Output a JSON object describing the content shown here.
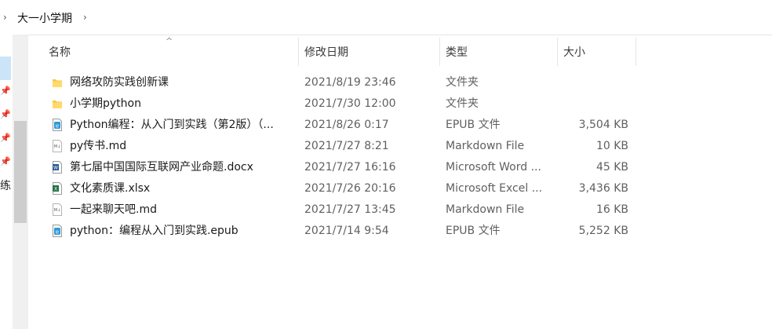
{
  "breadcrumb": {
    "back_chevron": "›",
    "folder": "大一小学期",
    "next_chevron": "›"
  },
  "nav": {
    "cut_text": "练",
    "pins": [
      "pin-icon",
      "pin-icon",
      "pin-icon",
      "pin-icon"
    ]
  },
  "columns": {
    "name": "名称",
    "modified": "修改日期",
    "type": "类型",
    "size": "大小",
    "sort_indicator": "^"
  },
  "files": [
    {
      "name": "网络攻防实践创新课",
      "modified": "2021/8/19 23:46",
      "type": "文件夹",
      "size": "",
      "icon": "folder-icon"
    },
    {
      "name": "小学期python",
      "modified": "2021/7/30 12:00",
      "type": "文件夹",
      "size": "",
      "icon": "folder-icon"
    },
    {
      "name": "Python编程：从入门到实践（第2版）（...",
      "modified": "2021/8/26 0:17",
      "type": "EPUB 文件",
      "size": "3,504 KB",
      "icon": "epub-icon"
    },
    {
      "name": "py传书.md",
      "modified": "2021/7/27 8:21",
      "type": "Markdown File",
      "size": "10 KB",
      "icon": "markdown-icon"
    },
    {
      "name": "第七届中国国际互联网产业命题.docx",
      "modified": "2021/7/27 16:16",
      "type": "Microsoft Word ...",
      "size": "45 KB",
      "icon": "word-icon"
    },
    {
      "name": "文化素质课.xlsx",
      "modified": "2021/7/26 20:16",
      "type": "Microsoft Excel ...",
      "size": "3,436 KB",
      "icon": "excel-icon"
    },
    {
      "name": "一起来聊天吧.md",
      "modified": "2021/7/27 13:45",
      "type": "Markdown File",
      "size": "16 KB",
      "icon": "markdown-icon"
    },
    {
      "name": "python：编程从入门到实践.epub",
      "modified": "2021/7/14 9:54",
      "type": "EPUB 文件",
      "size": "5,252 KB",
      "icon": "epub-icon"
    }
  ],
  "colors": {
    "folder": "#f8c843",
    "epub": "#2e9ad8",
    "word": "#2b579a",
    "excel": "#217346",
    "markdown": "#8a8a8a"
  }
}
